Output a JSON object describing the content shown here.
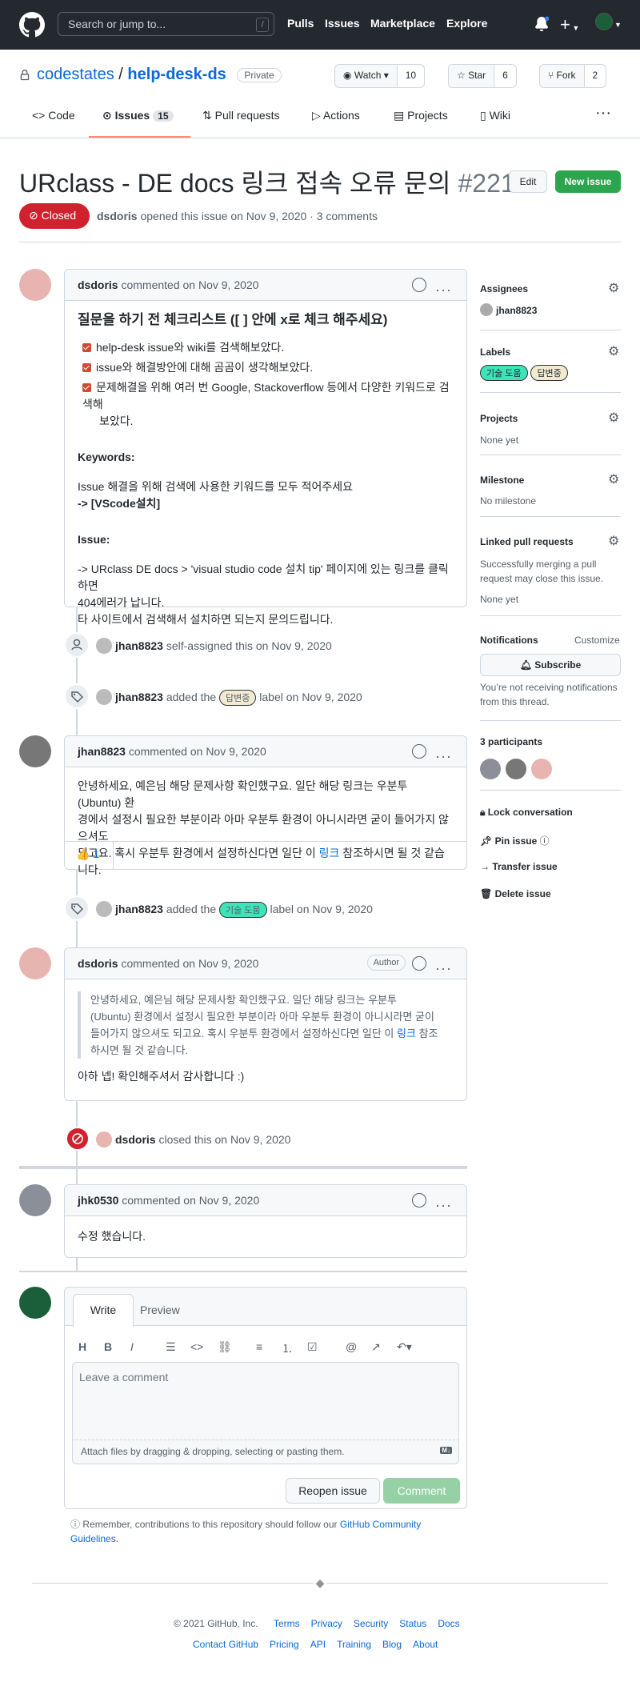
{
  "header": {
    "search_placeholder": "Search or jump to...",
    "search_shortcut": "/",
    "nav": [
      "Pulls",
      "Issues",
      "Marketplace",
      "Explore"
    ]
  },
  "repo": {
    "owner": "codestates",
    "separator": "/",
    "name": "help-desk-ds",
    "visibility": "Private",
    "watch_label": "Watch",
    "watch_count": "10",
    "star_label": "Star",
    "star_count": "6",
    "fork_label": "Fork",
    "fork_count": "2"
  },
  "tabs": [
    {
      "label": "Code"
    },
    {
      "label": "Issues",
      "count": "15"
    },
    {
      "label": "Pull requests"
    },
    {
      "label": "Actions"
    },
    {
      "label": "Projects"
    },
    {
      "label": "Wiki"
    }
  ],
  "issue": {
    "title": "URclass - DE docs 링크 접속 오류 문의",
    "number": "#221",
    "edit_label": "Edit",
    "new_issue_label": "New issue",
    "state": "Closed",
    "author": "dsdoris",
    "meta_text": "opened this issue on Nov 9, 2020 · 3 comments"
  },
  "comment1": {
    "author": "dsdoris",
    "action": "commented on Nov 9, 2020",
    "heading": "질문을 하기 전 체크리스트 ([ ] 안에 x로 체크 해주세요)",
    "checklist": [
      "help-desk issue와 wiki를 검색해보았다.",
      "issue와 해결방안에 대해 곰곰이 생각해보았다.",
      "문제해결을 위해 여러 번 Google, Stackoverflow 등에서 다양한 키워드로 검색해",
      "보았다."
    ],
    "keywords_label": "Keywords:",
    "keywords_text": "Issue 해결을 위해 검색에 사용한 키워드를 모두 적어주세요",
    "keywords_value": "-> [VScode설치]",
    "issue_label": "Issue:",
    "issue_lines": [
      "-> URclass DE docs > 'visual studio code 설치 tip' 페이지에 있는 링크를 클릭하면",
      "404에러가 납니다.",
      "타 사이트에서 검색해서 설치하면 되는지 문의드립니다."
    ]
  },
  "event_assign": {
    "user": "jhan8823",
    "text": "self-assigned this on Nov 9, 2020"
  },
  "event_label1": {
    "user": "jhan8823",
    "pre": "added the",
    "label": "답변중",
    "post": "label on Nov 9, 2020"
  },
  "comment2": {
    "author": "jhan8823",
    "action": "commented on Nov 9, 2020",
    "lines": [
      "안녕하세요, 예은님 해당 문제사항 확인했구요. 일단 해당 링크는 우분투 (Ubuntu) 환",
      "경에서 설정시 필요한 부분이라 아마 우분투 환경이 아니시라면 굳이 들어가지 않으셔도",
      "되고요. 혹시 우분투 환경에서 설정하신다면 일단 이"
    ],
    "link_text": "링크",
    "after_link": "참조하시면 될 것 같습니다.",
    "reaction_emoji": "👍",
    "reaction_count": "1"
  },
  "event_label2": {
    "user": "jhan8823",
    "pre": "added the",
    "label": "기술 도움",
    "post": "label on Nov 9, 2020"
  },
  "comment3": {
    "author": "dsdoris",
    "action": "commented on Nov 9, 2020",
    "badge": "Author",
    "quote_lines": [
      "안녕하세요, 예은님 해당 문제사항 확인했구요. 일단 해당 링크는 우분투",
      "(Ubuntu) 환경에서 설정시 필요한 부분이라 아마 우분투 환경이 아니시라면 굳이",
      "들어가지 않으셔도 되고요. 혹시 우분투 환경에서 설정하신다면 일단 이"
    ],
    "quote_link": "링크",
    "quote_after": "참조",
    "quote_last": "하시면 될 것 같습니다.",
    "reply": "아하 넵! 확인해주셔서 감사합니다 :)"
  },
  "event_closed": {
    "user": "dsdoris",
    "text": "closed this on Nov 9, 2020"
  },
  "comment4": {
    "author": "jhk0530",
    "action": "commented on Nov 9, 2020",
    "body": "수정 했습니다."
  },
  "editor": {
    "write_tab": "Write",
    "preview_tab": "Preview",
    "placeholder": "Leave a comment",
    "attach_text": "Attach files by dragging & dropping, selecting or pasting them.",
    "md_badge": "M↓",
    "reopen_label": "Reopen issue",
    "comment_label": "Comment",
    "note_text": "Remember, contributions to this repository should follow our",
    "note_link1": "GitHub Community",
    "note_link2": "Guidelines."
  },
  "sidebar": {
    "assignees_h": "Assignees",
    "assignee": "jhan8823",
    "labels_h": "Labels",
    "labels": [
      {
        "name": "기술 도움",
        "color": "#3fe3b8"
      },
      {
        "name": "답변중",
        "color": "#f2ead1"
      }
    ],
    "projects_h": "Projects",
    "projects_v": "None yet",
    "milestone_h": "Milestone",
    "milestone_v": "No milestone",
    "linked_h": "Linked pull requests",
    "linked_l1": "Successfully merging a pull",
    "linked_l2": "request may close this issue.",
    "linked_v": "None yet",
    "notif_h": "Notifications",
    "customize": "Customize",
    "subscribe": "Subscribe",
    "notif_l1": "You’re not receiving notifications",
    "notif_l2": "from this thread.",
    "participants_h": "3 participants",
    "lock": "Lock conversation",
    "pin": "Pin issue",
    "transfer": "Transfer issue",
    "delete": "Delete issue"
  },
  "footer": {
    "copyright": "© 2021 GitHub, Inc.",
    "row1": [
      "Terms",
      "Privacy",
      "Security",
      "Status",
      "Docs"
    ],
    "row2": [
      "Contact GitHub",
      "Pricing",
      "API",
      "Training",
      "Blog",
      "About"
    ]
  }
}
